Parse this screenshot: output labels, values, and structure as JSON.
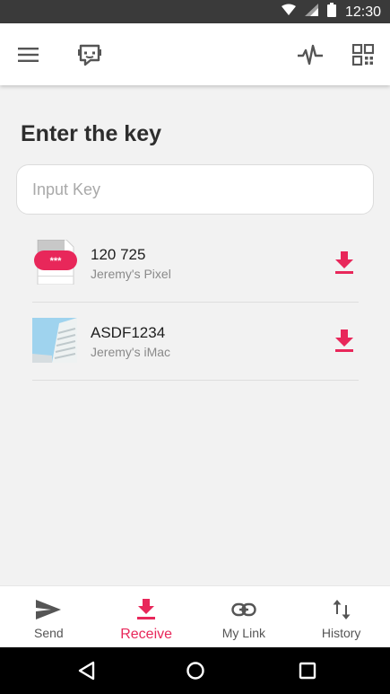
{
  "status_bar": {
    "time": "12:30",
    "icons": [
      "wifi-icon",
      "signal-icon",
      "battery-icon"
    ]
  },
  "app_bar": {
    "icons": [
      "menu-icon",
      "chat-icon",
      "pulse-icon",
      "qr-code-icon"
    ]
  },
  "main": {
    "heading": "Enter the key",
    "key_input": {
      "placeholder": "Input Key",
      "value": ""
    },
    "files": [
      {
        "name": "120 725",
        "device": "Jeremy's Pixel",
        "thumbnail": "password-file-icon",
        "action_icon": "download-icon"
      },
      {
        "name": "ASDF1234",
        "device": "Jeremy's iMac",
        "thumbnail": "building-photo",
        "action_icon": "download-icon"
      }
    ]
  },
  "bottom_nav": {
    "items": [
      {
        "label": "Send",
        "icon": "send-icon",
        "active": false
      },
      {
        "label": "Receive",
        "icon": "receive-icon",
        "active": true
      },
      {
        "label": "My Link",
        "icon": "link-icon",
        "active": false
      },
      {
        "label": "History",
        "icon": "history-icon",
        "active": false
      }
    ]
  },
  "system_nav": {
    "icons": [
      "back-icon",
      "home-icon",
      "recents-icon"
    ]
  },
  "colors": {
    "accent": "#e8275a",
    "status_bar": "#3a3a3a",
    "background": "#f2f2f2",
    "card": "#ffffff"
  }
}
